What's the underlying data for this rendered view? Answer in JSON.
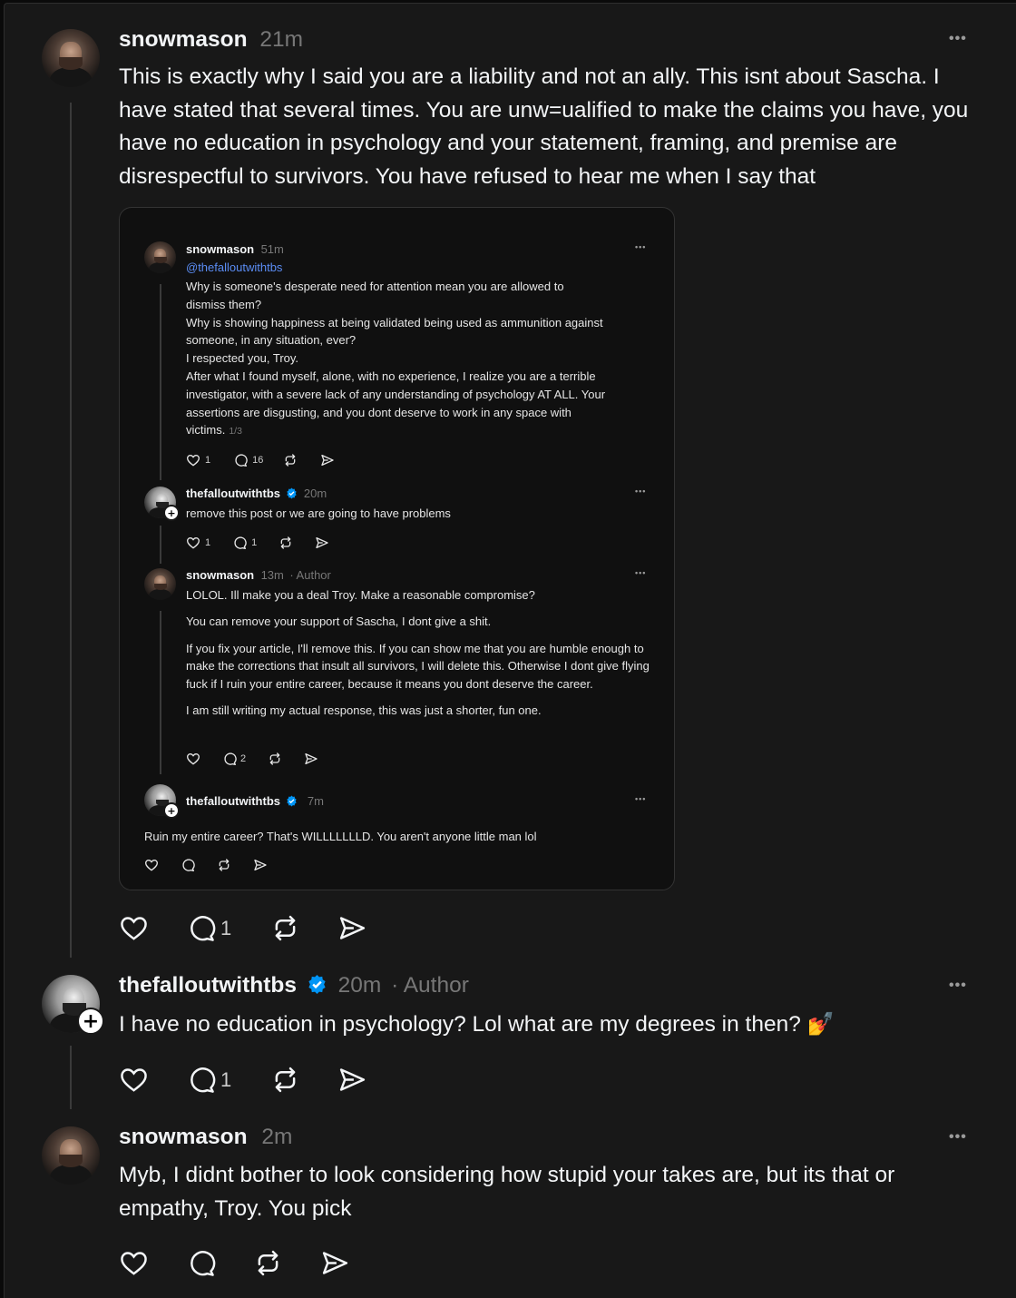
{
  "posts": [
    {
      "username": "snowmason",
      "time": "21m",
      "text": "This is exactly why I said you are a liability and not an ally. This isnt about Sascha. I have stated that several times. You are unw=ualified to make the claims you have, you have no education in psychology and your statement, framing, and premise are disrespectful to survivors. You have refused to hear me when I say that",
      "reply_count": "1"
    },
    {
      "username": "thefalloutwithtbs",
      "time": "20m",
      "author_tag": "· Author",
      "text": "I have no education in psychology? Lol what are my degrees in then? 💅",
      "reply_count": "1"
    },
    {
      "username": "snowmason",
      "time": "2m",
      "text": "Myb, I didnt bother to look considering how stupid your takes are, but its that or empathy, Troy. You pick",
      "reply_count": ""
    }
  ],
  "embedded": {
    "p1": {
      "username": "snowmason",
      "time": "51m",
      "mention": "@thefalloutwithtbs",
      "lines": [
        "Why is someone's desperate need for attention mean you are allowed to",
        "dismiss them?",
        "Why is showing happiness at being validated being used as ammunition against",
        "someone, in any situation, ever?",
        "I respected you, Troy.",
        "After what I found myself, alone, with no experience, I realize you are a terrible",
        "investigator, with a severe lack of any understanding of psychology AT ALL. Your",
        "assertions are disgusting, and you dont deserve to work in any space with",
        "victims."
      ],
      "pagination": "1/3",
      "likes": "1",
      "replies": "16"
    },
    "p2": {
      "username": "thefalloutwithtbs",
      "time": "20m",
      "text": "remove this post or we are going to have problems",
      "likes": "1",
      "replies": "1"
    },
    "p3": {
      "username": "snowmason",
      "time": "13m",
      "author_tag": "· Author",
      "paragraphs": [
        "LOLOL. Ill make you a deal Troy. Make a reasonable compromise?",
        "You can remove your support of Sascha, I dont give a shit.",
        "If you fix your article, I'll remove this. If you can show me that you are humble enough to make the corrections that insult all survivors, I will delete this. Otherwise I dont give flying fuck if I ruin your entire career, because it means you dont deserve the career.",
        "I am still writing my actual response, this was just a shorter, fun one."
      ],
      "replies": "2"
    },
    "p4": {
      "username": "thefalloutwithtbs",
      "time": "7m",
      "text": "Ruin my entire career? That's WILLLLLLLD. You aren't anyone little man lol"
    }
  },
  "ui": {
    "more_label": "•••",
    "plus_label": "+"
  },
  "colors": {
    "background": "#181818",
    "text": "#f3f5f7",
    "muted": "#777777",
    "link": "#5b8df5",
    "verified": "#0095f6"
  }
}
